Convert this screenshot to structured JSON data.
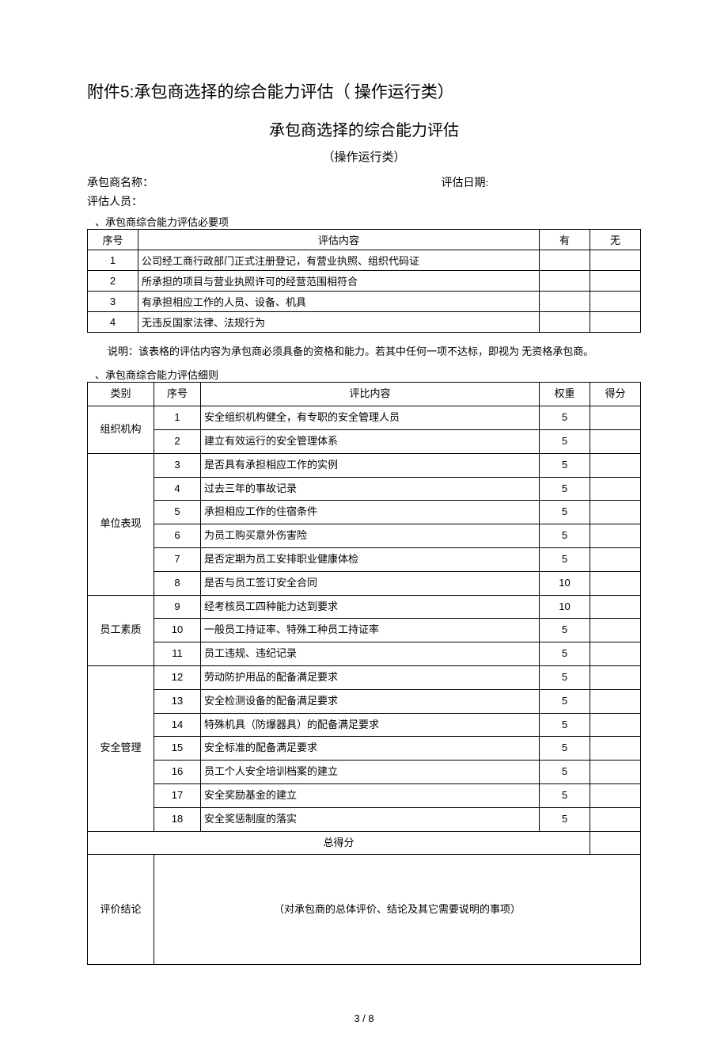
{
  "heading1_prefix": "附件",
  "heading1_num": "5:",
  "heading1_rest": "承包商选择的综合能力评估（ 操作运行类）",
  "heading2": "承包商选择的综合能力评估",
  "heading3": "（操作运行类）",
  "meta": {
    "contractor_label": "承包商名称：",
    "date_label": "评估日期:",
    "staff_label": "评估人员："
  },
  "section1_label": "、承包商综合能力评估必要项",
  "table1": {
    "head": {
      "seq": "序号",
      "content": "评估内容",
      "yes": "有",
      "no": "无"
    },
    "rows": [
      {
        "seq": "1",
        "content": "公司经工商行政部门正式注册登记，有营业执照、组织代码证"
      },
      {
        "seq": "2",
        "content": "所承担的项目与营业执照许可的经营范围相符合"
      },
      {
        "seq": "3",
        "content": "有承担相应工作的人员、设备、机具"
      },
      {
        "seq": "4",
        "content": "无违反国家法律、法规行为"
      }
    ]
  },
  "note": "说明：该表格的评估内容为承包商必须具备的资格和能力。若其中任何一项不达标，即视为 无资格承包商。",
  "section2_label": "、承包商综合能力评估细则",
  "table2": {
    "head": {
      "cat": "类别",
      "idx": "序号",
      "item": "评比内容",
      "weight": "权重",
      "score": "得分"
    },
    "groups": [
      {
        "cat": "组织机构",
        "rows": [
          {
            "idx": "1",
            "item": "安全组织机构健全，有专职的安全管理人员",
            "weight": "5"
          },
          {
            "idx": "2",
            "item": "建立有效运行的安全管理体系",
            "weight": "5"
          }
        ]
      },
      {
        "cat": "单位表现",
        "rows": [
          {
            "idx": "3",
            "item": "是否具有承担相应工作的实例",
            "weight": "5"
          },
          {
            "idx": "4",
            "item": "过去三年的事故记录",
            "weight": "5"
          },
          {
            "idx": "5",
            "item": "承担相应工作的住宿条件",
            "weight": "5"
          },
          {
            "idx": "6",
            "item": "为员工购买意外伤害险",
            "weight": "5"
          },
          {
            "idx": "7",
            "item": "是否定期为员工安排职业健康体检",
            "weight": "5"
          },
          {
            "idx": "8",
            "item": "是否与员工签订安全合同",
            "weight": "10"
          }
        ]
      },
      {
        "cat": "员工素质",
        "rows": [
          {
            "idx": "9",
            "item": "经考核员工四种能力达到要求",
            "weight": "10"
          },
          {
            "idx": "10",
            "item": "一般员工持证率、特殊工种员工持证率",
            "weight": "5"
          },
          {
            "idx": "11",
            "item": "员工违规、违纪记录",
            "weight": "5"
          }
        ]
      },
      {
        "cat": "安全管理",
        "rows": [
          {
            "idx": "12",
            "item": "劳动防护用品的配备满足要求",
            "weight": "5"
          },
          {
            "idx": "13",
            "item": "安全检测设备的配备满足要求",
            "weight": "5"
          },
          {
            "idx": "14",
            "item": "特殊机具（防爆器具）的配备满足要求",
            "weight": "5"
          },
          {
            "idx": "15",
            "item": "安全标准的配备满足要求",
            "weight": "5"
          },
          {
            "idx": "16",
            "item": "员工个人安全培训档案的建立",
            "weight": "5"
          },
          {
            "idx": "17",
            "item": "安全奖励基金的建立",
            "weight": "5"
          },
          {
            "idx": "18",
            "item": "安全奖惩制度的落实",
            "weight": "5"
          }
        ]
      }
    ],
    "total_label": "总得分",
    "conclusion_label": "评价结论",
    "conclusion_hint": "（对承包商的总体评价、结论及其它需要说明的事项）"
  },
  "footer": "3 / 8"
}
